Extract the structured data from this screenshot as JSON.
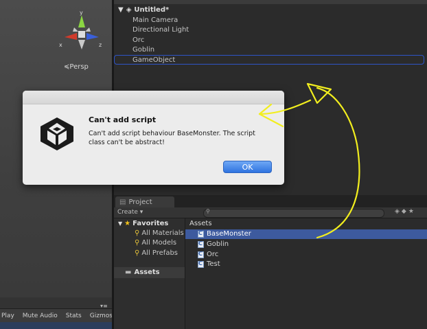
{
  "scene_view": {
    "persp_label": "Persp",
    "gizmo": {
      "x_label": "x",
      "z_label": "z",
      "y_label": "y"
    },
    "toolbar": [
      "Play",
      "Mute Audio",
      "Stats",
      "Gizmos"
    ],
    "toolbar_dropdown": "▾",
    "panel_menu": "▾≡"
  },
  "hierarchy": {
    "scene_name": "Untitled*",
    "items": [
      "Main Camera",
      "Directional Light",
      "Orc",
      "Goblin",
      "GameObject"
    ],
    "selected_index": 4
  },
  "project": {
    "tab_label": "Project",
    "create_label": "Create ▾",
    "search_placeholder": "",
    "favorites_label": "Favorites",
    "favorites": [
      "All Materials",
      "All Models",
      "All Prefabs"
    ],
    "assets_folder": "Assets",
    "assets_header": "Assets",
    "assets": [
      "BaseMonster",
      "Goblin",
      "Orc",
      "Test"
    ],
    "selected_asset": "BaseMonster"
  },
  "dialog": {
    "title": "Can't add script",
    "message": "Can't add script behaviour BaseMonster. The script class can't be abstract!",
    "ok_label": "OK"
  },
  "colors": {
    "annotation": "#f2ee1e",
    "selection_outline": "#2f55c9",
    "selection_fill": "#3d5a9e",
    "ok_button": "#2f73e0"
  }
}
